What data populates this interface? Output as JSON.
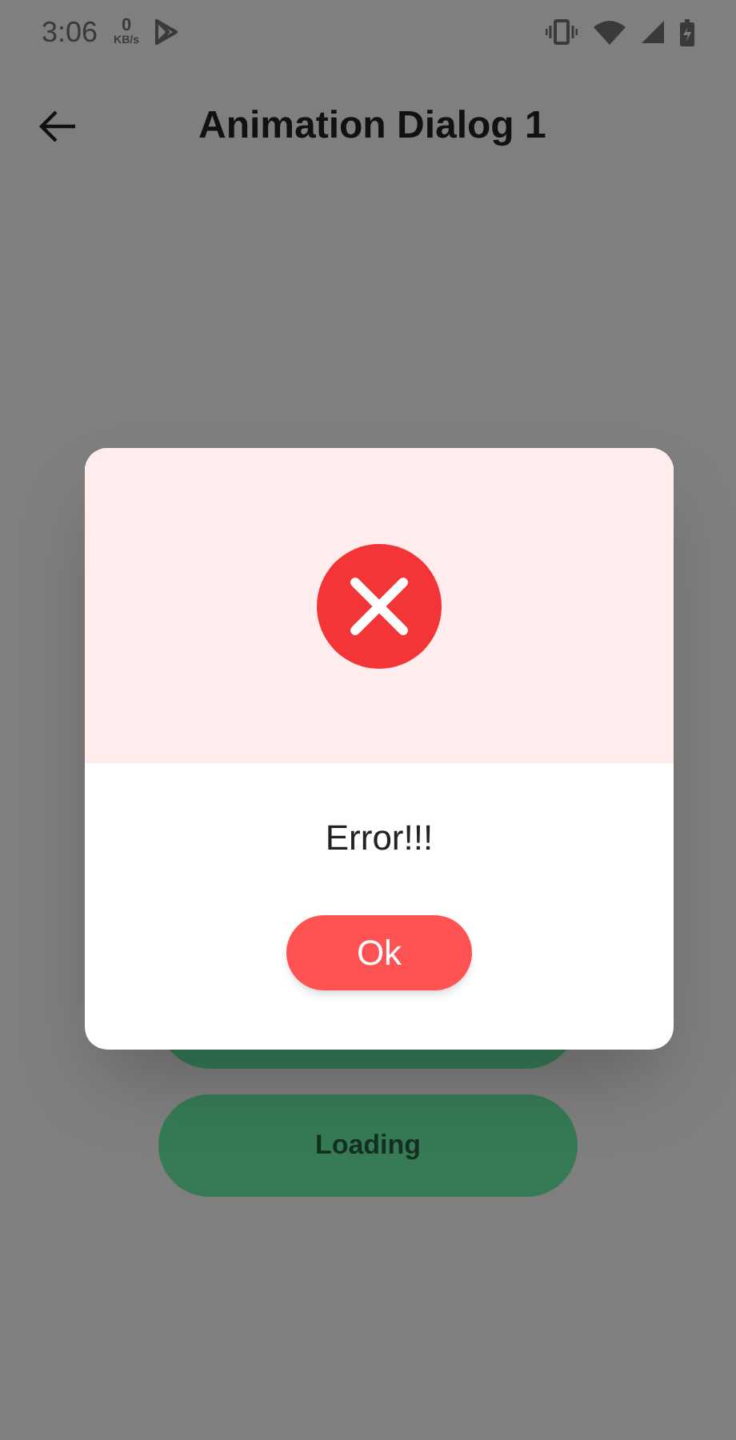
{
  "status_bar": {
    "time": "3:06",
    "net_speed": "0",
    "net_unit": "KB/s"
  },
  "app_bar": {
    "title": "Animation Dialog 1"
  },
  "buttons": [
    {
      "label": "Loading"
    }
  ],
  "dialog": {
    "kind": "error",
    "title": "Error!!!",
    "button": "Ok"
  }
}
